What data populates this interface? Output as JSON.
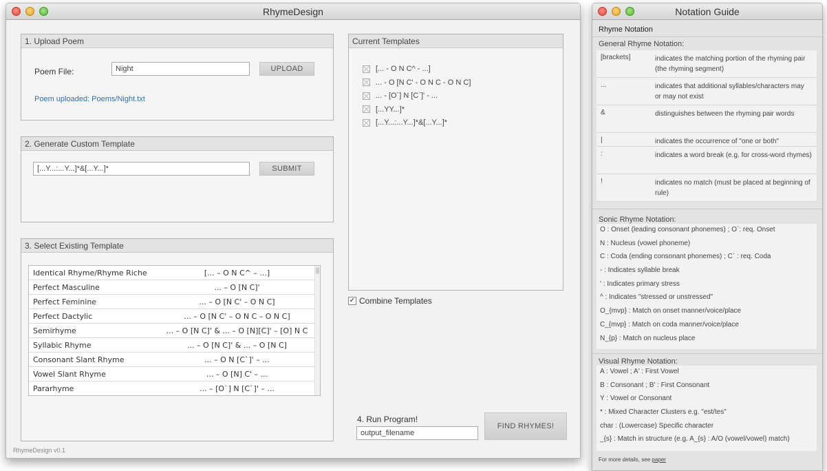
{
  "main_window": {
    "title": "RhymeDesign",
    "footer": "RhymeDesign v0.1",
    "upload": {
      "header": "1. Upload Poem",
      "file_label": "Poem File:",
      "file_value": "Night",
      "button": "UPLOAD",
      "status": "Poem uploaded: Poems/Night.txt"
    },
    "custom": {
      "header": "2. Generate Custom Template",
      "value": "[...Y...:...Y...]*&[...Y...]*",
      "button": "SUBMIT"
    },
    "existing": {
      "header": "3. Select Existing Template",
      "rows": [
        {
          "name": "Identical Rhyme/Rhyme Riche",
          "rule": "[... – O N C^ – ...]"
        },
        {
          "name": "Perfect Masculine",
          "rule": "... – O [N C]'"
        },
        {
          "name": "Perfect Feminine",
          "rule": "... – O [N C' – O N C]"
        },
        {
          "name": "Perfect Dactylic",
          "rule": "... – O [N C' – O N C – O N C]"
        },
        {
          "name": "Semirhyme",
          "rule": "... – O [N C]' & ... – O [N][C]' – [O] N C"
        },
        {
          "name": "Syllabic Rhyme",
          "rule": "... – O [N C]' & ... – O [N C]"
        },
        {
          "name": "Consonant Slant Rhyme",
          "rule": "... – O N [C`]' – ..."
        },
        {
          "name": "Vowel Slant Rhyme",
          "rule": "... – O [N] C' – ..."
        },
        {
          "name": "Pararhyme",
          "rule": "... – [O`] N [C`]' – ..."
        }
      ]
    },
    "current": {
      "header": "Current Templates",
      "items": [
        "[... - O N C^ - ...]",
        "... - O [N C' - O N C - O N C]",
        "... - [O`] N [C`]' - ...",
        "[...YY...]*",
        "[...Y...:...Y...]*&[...Y...]*"
      ]
    },
    "combine": {
      "label": "Combine Templates",
      "checked": true,
      "mark": "✓"
    },
    "run": {
      "label": "4. Run Program!",
      "output_value": "output_filename",
      "button": "FIND RHYMES!"
    }
  },
  "guide_window": {
    "title": "Notation Guide",
    "heading": "Rhyme Notation",
    "general": {
      "title": "General Rhyme Notation:",
      "rows": [
        {
          "sym": "[brackets]",
          "desc": "indicates the matching portion of the rhyming pair (the rhyming segment)"
        },
        {
          "sym": "...",
          "desc": "indicates that additional syllables/characters may or may not exist"
        },
        {
          "sym": "&",
          "desc": "distinguishes between the rhyming pair words"
        },
        {
          "sym": "|",
          "desc": "indicates the occurrence of \"one or both\""
        },
        {
          "sym": ":",
          "desc": "indicates a word break (e.g. for cross-word rhymes)"
        },
        {
          "sym": "!",
          "desc": "indicates no match (must be placed at beginning of rule)"
        }
      ]
    },
    "sonic": {
      "title": "Sonic Rhyme Notation:",
      "lines": [
        "O :  Onset (leading consonant phonemes) ; O`: req. Onset",
        "N :  Nucleus (vowel phoneme)",
        "C :  Coda (ending consonant phonemes) ; C` : req. Coda",
        " - : Indicates syllable break",
        "' :  Indicates primary stress",
        "^ :  Indicates \"stressed or unstressed\"",
        "O_{mvp} : Match on onset manner/voice/place",
        "C_{mvp} : Match on coda manner/voice/place",
        "N_{p} : Match on nucleus place"
      ]
    },
    "visual": {
      "title": "Visual Rhyme Notation:",
      "lines": [
        "A :  Vowel ; A' : First Vowel",
        "B :  Consonant ; B' : First Consonant",
        "Y :  Vowel or Consonant",
        "* : Mixed Character Clusters e.g. \"est/tes\"",
        " char : (Lowercase) Specific character",
        "_{s} :  Match in structure (e.g. A_{s} : A/O (vowel/vowel) match)"
      ]
    },
    "footer": {
      "text": "For more details, see ",
      "link": "paper"
    }
  }
}
